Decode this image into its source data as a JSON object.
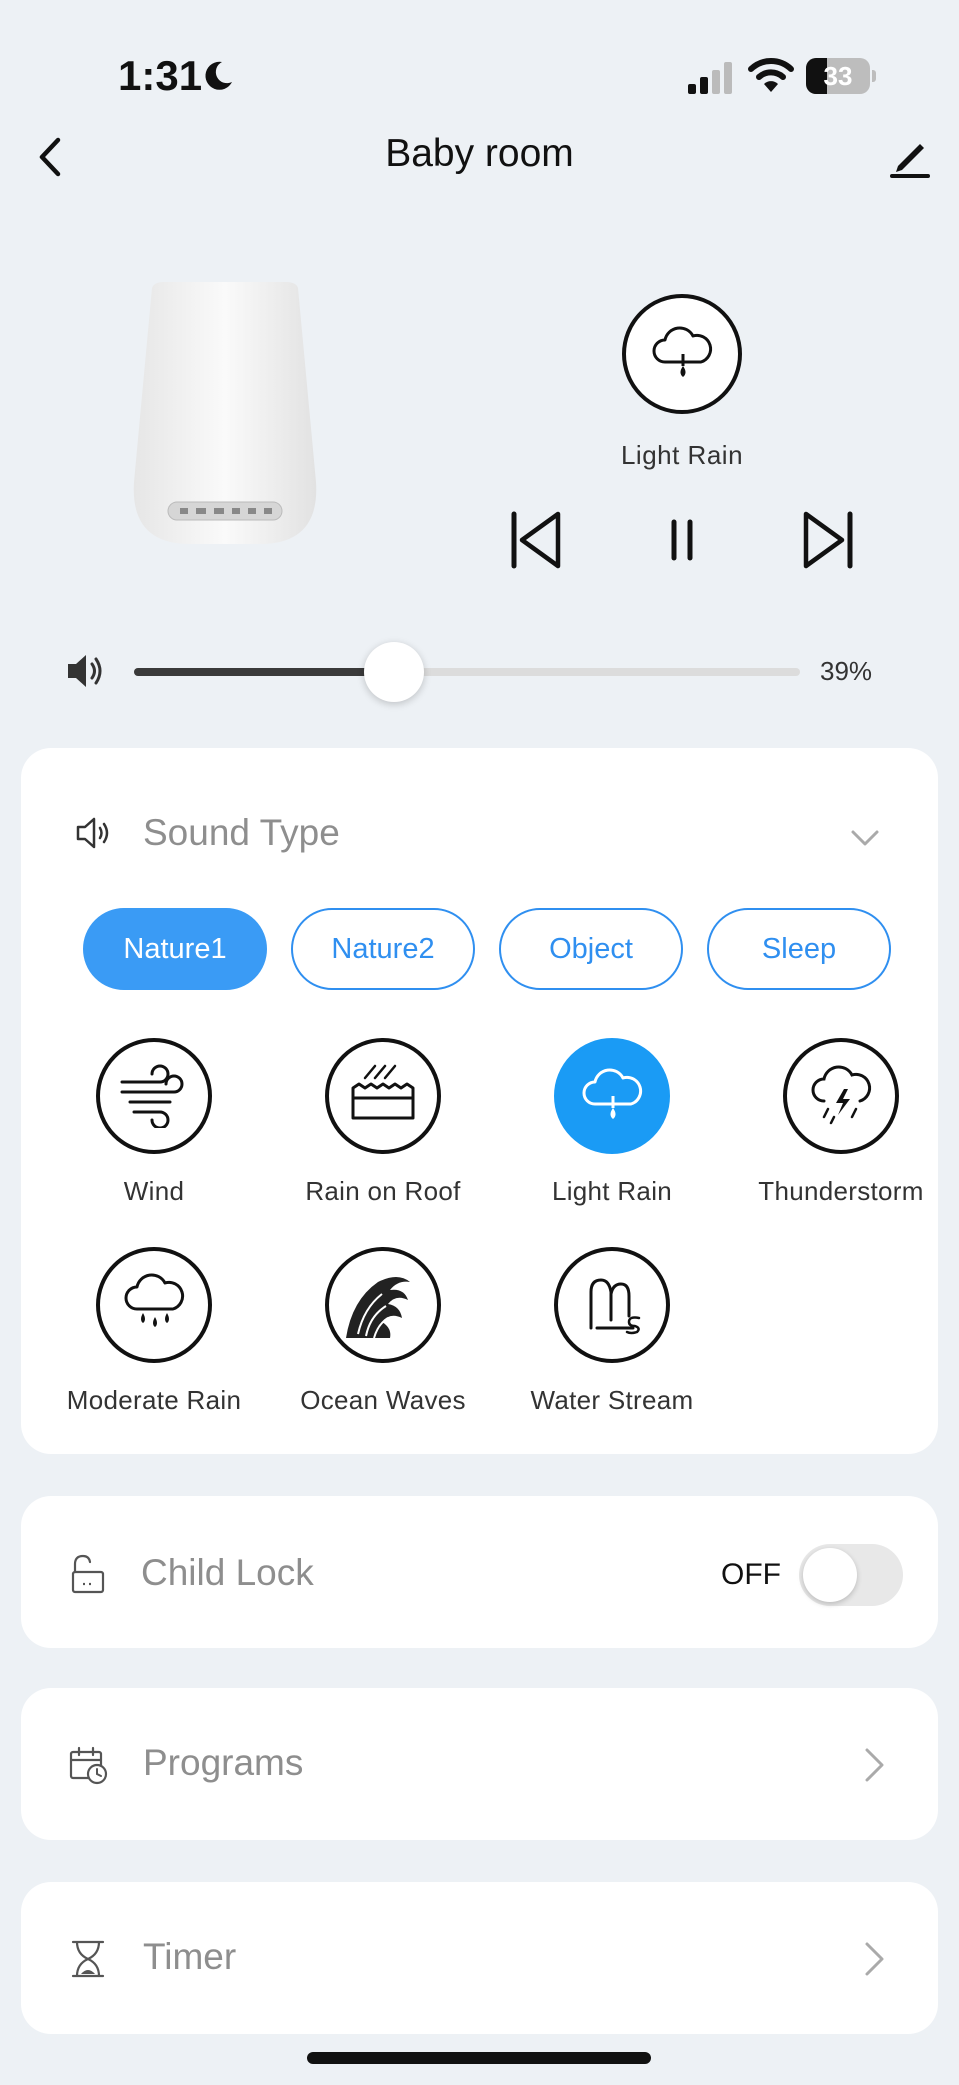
{
  "status_bar": {
    "time": "1:31",
    "battery": "33",
    "battery_level": 0.33
  },
  "header": {
    "title": "Baby room"
  },
  "player": {
    "now_playing": "Light Rain"
  },
  "volume": {
    "value_label": "39%",
    "level": 0.39
  },
  "sound_type": {
    "label": "Sound Type",
    "tabs": [
      {
        "label": "Nature1",
        "active": true
      },
      {
        "label": "Nature2",
        "active": false
      },
      {
        "label": "Object",
        "active": false
      },
      {
        "label": "Sleep",
        "active": false
      }
    ],
    "sounds": [
      {
        "label": "Wind",
        "icon": "wind-icon"
      },
      {
        "label": "Rain on Roof",
        "icon": "rain-on-roof-icon"
      },
      {
        "label": "Light Rain",
        "icon": "light-rain-icon",
        "selected": true
      },
      {
        "label": "Thunderstorm",
        "icon": "thunderstorm-icon"
      },
      {
        "label": "Moderate Rain",
        "icon": "moderate-rain-icon"
      },
      {
        "label": "Ocean Waves",
        "icon": "ocean-waves-icon"
      },
      {
        "label": "Water Stream",
        "icon": "water-stream-icon"
      }
    ]
  },
  "child_lock": {
    "label": "Child Lock",
    "state": "OFF"
  },
  "programs": {
    "label": "Programs"
  },
  "timer": {
    "label": "Timer"
  },
  "colors": {
    "accent": "#3a9bf5",
    "selected": "#1a9bf5",
    "background": "#edf1f5"
  }
}
